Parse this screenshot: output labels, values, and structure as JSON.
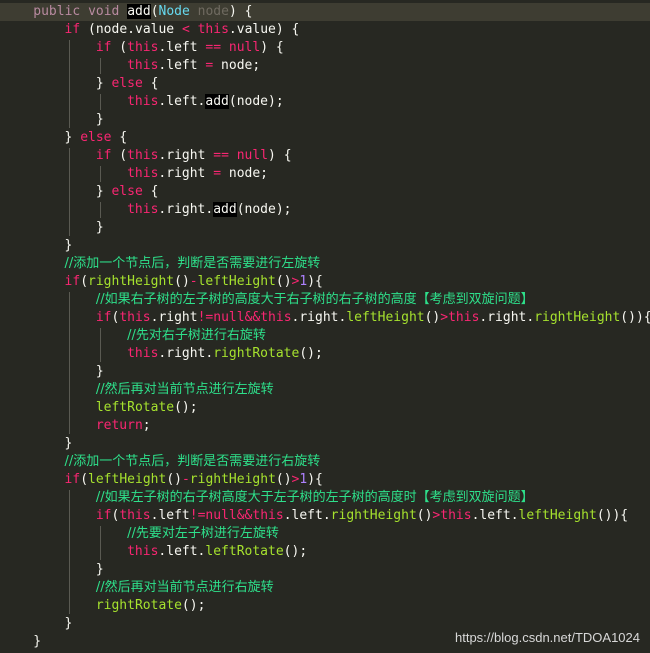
{
  "editor": {
    "lines": [
      {
        "indent": 4,
        "current": true,
        "tokens": [
          [
            "dim",
            "public"
          ],
          [
            "pl",
            " "
          ],
          [
            "dim",
            "void"
          ],
          [
            "pl",
            " "
          ],
          [
            "mark",
            "add"
          ],
          [
            "pl",
            "("
          ],
          [
            "ty",
            "Node"
          ],
          [
            "pl",
            " "
          ],
          [
            "dimn",
            "node"
          ],
          [
            "pl",
            ") {"
          ]
        ]
      },
      {
        "indent": 8,
        "tokens": [
          [
            "kw",
            "if"
          ],
          [
            "pl",
            " (node.value "
          ],
          [
            "op",
            "<"
          ],
          [
            "pl",
            " "
          ],
          [
            "th",
            "this"
          ],
          [
            "pl",
            ".value) {"
          ]
        ]
      },
      {
        "indent": 12,
        "tokens": [
          [
            "kw",
            "if"
          ],
          [
            "pl",
            " ("
          ],
          [
            "th",
            "this"
          ],
          [
            "pl",
            ".left "
          ],
          [
            "op",
            "=="
          ],
          [
            "pl",
            " "
          ],
          [
            "kw",
            "null"
          ],
          [
            "pl",
            ") {"
          ]
        ]
      },
      {
        "indent": 16,
        "tokens": [
          [
            "th",
            "this"
          ],
          [
            "pl",
            ".left "
          ],
          [
            "op",
            "="
          ],
          [
            "pl",
            " node;"
          ]
        ]
      },
      {
        "indent": 12,
        "tokens": [
          [
            "pl",
            "} "
          ],
          [
            "kw",
            "else"
          ],
          [
            "pl",
            " {"
          ]
        ]
      },
      {
        "indent": 16,
        "tokens": [
          [
            "th",
            "this"
          ],
          [
            "pl",
            ".left."
          ],
          [
            "mark",
            "add"
          ],
          [
            "pl",
            "(node);"
          ]
        ]
      },
      {
        "indent": 12,
        "tokens": [
          [
            "pl",
            "}"
          ]
        ]
      },
      {
        "indent": 8,
        "tokens": [
          [
            "pl",
            "} "
          ],
          [
            "kw",
            "else"
          ],
          [
            "pl",
            " {"
          ]
        ]
      },
      {
        "indent": 12,
        "tokens": [
          [
            "kw",
            "if"
          ],
          [
            "pl",
            " ("
          ],
          [
            "th",
            "this"
          ],
          [
            "pl",
            ".right "
          ],
          [
            "op",
            "=="
          ],
          [
            "pl",
            " "
          ],
          [
            "kw",
            "null"
          ],
          [
            "pl",
            ") {"
          ]
        ]
      },
      {
        "indent": 16,
        "tokens": [
          [
            "th",
            "this"
          ],
          [
            "pl",
            ".right "
          ],
          [
            "op",
            "="
          ],
          [
            "pl",
            " node;"
          ]
        ]
      },
      {
        "indent": 12,
        "tokens": [
          [
            "pl",
            "} "
          ],
          [
            "kw",
            "else"
          ],
          [
            "pl",
            " {"
          ]
        ]
      },
      {
        "indent": 16,
        "tokens": [
          [
            "th",
            "this"
          ],
          [
            "pl",
            ".right."
          ],
          [
            "mark",
            "add"
          ],
          [
            "pl",
            "(node);"
          ]
        ]
      },
      {
        "indent": 12,
        "tokens": [
          [
            "pl",
            "}"
          ]
        ]
      },
      {
        "indent": 8,
        "tokens": [
          [
            "pl",
            "}"
          ]
        ]
      },
      {
        "indent": 8,
        "tokens": [
          [
            "cm",
            "//添加一个节点后，判断是否需要进行左旋转"
          ]
        ]
      },
      {
        "indent": 8,
        "tokens": [
          [
            "kw",
            "if"
          ],
          [
            "pl",
            "("
          ],
          [
            "fn",
            "rightHeight"
          ],
          [
            "pl",
            "()"
          ],
          [
            "op",
            "-"
          ],
          [
            "fn",
            "leftHeight"
          ],
          [
            "pl",
            "()"
          ],
          [
            "op",
            ">"
          ],
          [
            "num",
            "1"
          ],
          [
            "pl",
            "){"
          ]
        ]
      },
      {
        "indent": 12,
        "tokens": [
          [
            "cm",
            "//如果右子树的左子树的高度大于右子树的右子树的高度【考虑到双旋问题】"
          ]
        ]
      },
      {
        "indent": 12,
        "tokens": [
          [
            "kw",
            "if"
          ],
          [
            "pl",
            "("
          ],
          [
            "th",
            "this"
          ],
          [
            "pl",
            ".right"
          ],
          [
            "op",
            "!="
          ],
          [
            "kw",
            "null"
          ],
          [
            "op",
            "&&"
          ],
          [
            "th",
            "this"
          ],
          [
            "pl",
            ".right."
          ],
          [
            "fn",
            "leftHeight"
          ],
          [
            "pl",
            "()"
          ],
          [
            "op",
            ">"
          ],
          [
            "th",
            "this"
          ],
          [
            "pl",
            ".right."
          ],
          [
            "fn",
            "rightHeight"
          ],
          [
            "pl",
            "()){"
          ]
        ]
      },
      {
        "indent": 16,
        "tokens": [
          [
            "cm",
            "//先对右子树进行右旋转"
          ]
        ]
      },
      {
        "indent": 16,
        "tokens": [
          [
            "th",
            "this"
          ],
          [
            "pl",
            ".right."
          ],
          [
            "fn",
            "rightRotate"
          ],
          [
            "pl",
            "();"
          ]
        ]
      },
      {
        "indent": 12,
        "tokens": [
          [
            "pl",
            "}"
          ]
        ]
      },
      {
        "indent": 12,
        "tokens": [
          [
            "cm",
            "//然后再对当前节点进行左旋转"
          ]
        ]
      },
      {
        "indent": 12,
        "tokens": [
          [
            "fn",
            "leftRotate"
          ],
          [
            "pl",
            "();"
          ]
        ]
      },
      {
        "indent": 12,
        "tokens": [
          [
            "kw",
            "return"
          ],
          [
            "pl",
            ";"
          ]
        ]
      },
      {
        "indent": 8,
        "tokens": [
          [
            "pl",
            "}"
          ]
        ]
      },
      {
        "indent": 8,
        "tokens": [
          [
            "cm",
            "//添加一个节点后，判断是否需要进行右旋转"
          ]
        ]
      },
      {
        "indent": 8,
        "tokens": [
          [
            "kw",
            "if"
          ],
          [
            "pl",
            "("
          ],
          [
            "fn",
            "leftHeight"
          ],
          [
            "pl",
            "()"
          ],
          [
            "op",
            "-"
          ],
          [
            "fn",
            "rightHeight"
          ],
          [
            "pl",
            "()"
          ],
          [
            "op",
            ">"
          ],
          [
            "num",
            "1"
          ],
          [
            "pl",
            "){"
          ]
        ]
      },
      {
        "indent": 12,
        "tokens": [
          [
            "cm",
            "//如果左子树的右子树高度大于左子树的左子树的高度时【考虑到双旋问题】"
          ]
        ]
      },
      {
        "indent": 12,
        "tokens": [
          [
            "kw",
            "if"
          ],
          [
            "pl",
            "("
          ],
          [
            "th",
            "this"
          ],
          [
            "pl",
            ".left"
          ],
          [
            "op",
            "!="
          ],
          [
            "kw",
            "null"
          ],
          [
            "op",
            "&&"
          ],
          [
            "th",
            "this"
          ],
          [
            "pl",
            ".left."
          ],
          [
            "fn",
            "rightHeight"
          ],
          [
            "pl",
            "()"
          ],
          [
            "op",
            ">"
          ],
          [
            "th",
            "this"
          ],
          [
            "pl",
            ".left."
          ],
          [
            "fn",
            "leftHeight"
          ],
          [
            "pl",
            "()){"
          ]
        ]
      },
      {
        "indent": 16,
        "tokens": [
          [
            "cm",
            "//先要对左子树进行左旋转"
          ]
        ]
      },
      {
        "indent": 16,
        "tokens": [
          [
            "th",
            "this"
          ],
          [
            "pl",
            ".left."
          ],
          [
            "fn",
            "leftRotate"
          ],
          [
            "pl",
            "();"
          ]
        ]
      },
      {
        "indent": 12,
        "tokens": [
          [
            "pl",
            "}"
          ]
        ]
      },
      {
        "indent": 12,
        "tokens": [
          [
            "cm",
            "//然后再对当前节点进行右旋转"
          ]
        ]
      },
      {
        "indent": 12,
        "tokens": [
          [
            "fn",
            "rightRotate"
          ],
          [
            "pl",
            "();"
          ]
        ]
      },
      {
        "indent": 8,
        "tokens": [
          [
            "pl",
            "}"
          ]
        ]
      },
      {
        "indent": 4,
        "tokens": [
          [
            "pl",
            "}"
          ]
        ]
      }
    ]
  },
  "watermark": "https://blog.csdn.net/TDOA1024",
  "colors": {
    "background": "#272822",
    "current_line": "#3E3D32",
    "keyword": "#F92672",
    "function": "#A6E22E",
    "type": "#66D9EF",
    "comment": "#2EE08B",
    "plain": "#F8F8F2"
  }
}
